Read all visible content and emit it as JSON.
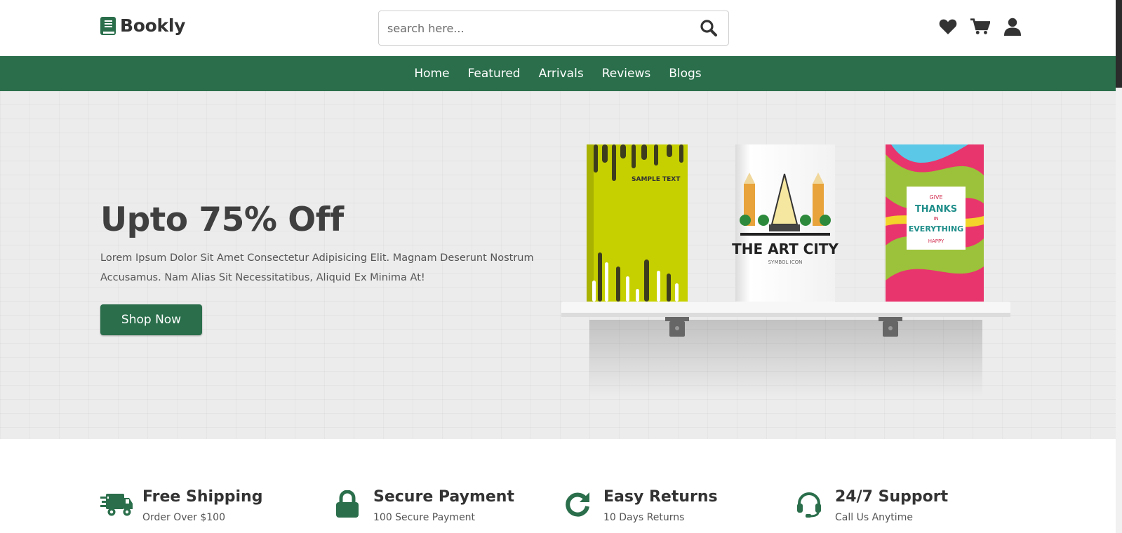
{
  "brand": {
    "name": "Bookly",
    "accent": "#2a6e4b"
  },
  "search": {
    "placeholder": "search here..."
  },
  "header_icons": [
    "heart-icon",
    "cart-icon",
    "user-icon"
  ],
  "nav": {
    "items": [
      "Home",
      "Featured",
      "Arrivals",
      "Reviews",
      "Blogs"
    ]
  },
  "hero": {
    "title": "Upto 75% Off",
    "description": "Lorem Ipsum Dolor Sit Amet Consectetur Adipisicing Elit. Magnam Deserunt Nostrum Accusamus. Nam Alias Sit Necessitatibus, Aliquid Ex Minima At!",
    "button": "Shop Now",
    "books": [
      {
        "cover_text": "SAMPLE TEXT",
        "color": "#c8d400"
      },
      {
        "cover_title": "THE ART CITY",
        "cover_sub": "SYMBOL ICON",
        "color": "#ffffff"
      },
      {
        "cover_lines": [
          "GIVE",
          "THANKS",
          "IN",
          "EVERYTHING",
          "HAPPY"
        ],
        "color": "#e8356d"
      }
    ]
  },
  "features": [
    {
      "icon": "truck-icon",
      "title": "Free Shipping",
      "subtitle": "Order Over $100"
    },
    {
      "icon": "lock-icon",
      "title": "Secure Payment",
      "subtitle": "100 Secure Payment"
    },
    {
      "icon": "redo-icon",
      "title": "Easy Returns",
      "subtitle": "10 Days Returns"
    },
    {
      "icon": "headset-icon",
      "title": "24/7 Support",
      "subtitle": "Call Us Anytime"
    }
  ]
}
